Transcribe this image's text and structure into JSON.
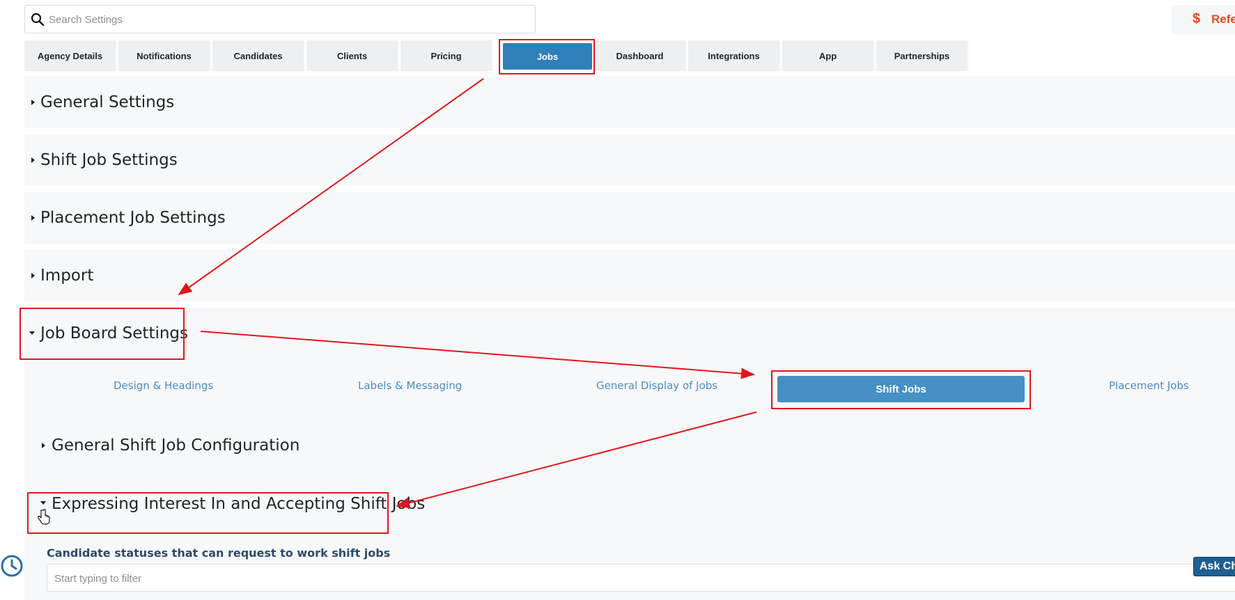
{
  "search": {
    "placeholder": "Search Settings",
    "icon": "search-icon"
  },
  "referral": {
    "label": "Refe",
    "icon": "dollar-icon",
    "color": "#e04b1a"
  },
  "tabs": [
    {
      "label": "Agency Details"
    },
    {
      "label": "Notifications"
    },
    {
      "label": "Candidates"
    },
    {
      "label": "Clients"
    },
    {
      "label": "Pricing"
    },
    {
      "label": "Jobs",
      "active": true
    },
    {
      "label": "Dashboard"
    },
    {
      "label": "Integrations"
    },
    {
      "label": "App"
    },
    {
      "label": "Partnerships"
    }
  ],
  "sections": [
    {
      "title": "General Settings",
      "expanded": false
    },
    {
      "title": "Shift Job Settings",
      "expanded": false
    },
    {
      "title": "Placement Job Settings",
      "expanded": false
    },
    {
      "title": "Import",
      "expanded": false
    },
    {
      "title": "Job Board Settings",
      "expanded": true
    }
  ],
  "job_board": {
    "subtabs": [
      {
        "label": "Design & Headings"
      },
      {
        "label": "Labels & Messaging"
      },
      {
        "label": "General Display of Jobs"
      },
      {
        "label": "Shift Jobs",
        "active": true
      },
      {
        "label": "Placement Jobs"
      }
    ],
    "subsections": [
      {
        "title": "General Shift Job Configuration",
        "expanded": false
      },
      {
        "title": "Expressing Interest In and Accepting Shift Jobs",
        "expanded": true
      }
    ],
    "field_label": "Candidate statuses that can request to work shift jobs",
    "filter_placeholder": "Start typing to filter"
  },
  "ask_button": {
    "label": "Ask Ch"
  },
  "colors": {
    "accent": "#2f7fb9",
    "annotation": "#e0161c"
  }
}
